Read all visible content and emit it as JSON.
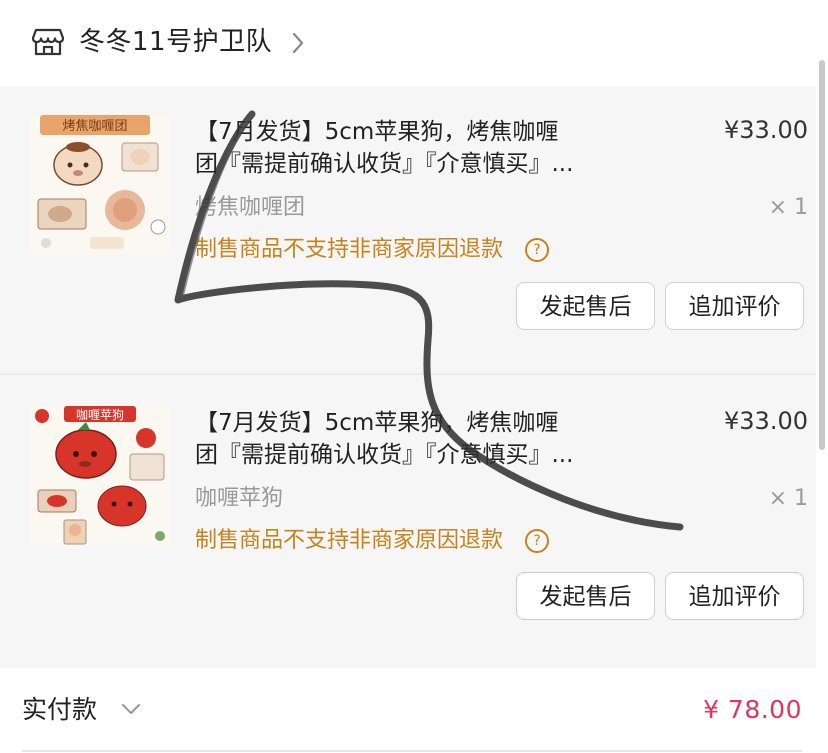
{
  "shop": {
    "name": "冬冬11号护卫队",
    "icon": "store-icon",
    "chevron_icon": "chevron-right-icon"
  },
  "items": [
    {
      "title_line1": "【7月发货】5cm苹果狗，烤焦咖喱",
      "title_line2": "团『需提前确认收货』『介意慎买』...",
      "price": "¥33.00",
      "spec": "烤焦咖喱团",
      "quantity": "× 1",
      "notice": "制售商品不支持非商家原因退款",
      "help_icon": "question-circle-icon",
      "thumb_label": "烤焦咖喱团",
      "aftersale_button": "发起售后",
      "review_button": "追加评价"
    },
    {
      "title_line1": "【7月发货】5cm苹果狗，烤焦咖喱",
      "title_line2": "团『需提前确认收货』『介意慎买』...",
      "price": "¥33.00",
      "spec": "咖喱苹狗",
      "quantity": "× 1",
      "notice": "制售商品不支持非商家原因退款",
      "help_icon": "question-circle-icon",
      "thumb_label": "咖喱苹狗",
      "aftersale_button": "发起售后",
      "review_button": "追加评价"
    }
  ],
  "footer": {
    "pay_label": "实付款",
    "pay_chevron_icon": "chevron-down-icon",
    "total": "¥ 78.00"
  },
  "colors": {
    "notice": "#c9821b",
    "total": "#e8325a",
    "card_bg": "#f6f6f6"
  }
}
